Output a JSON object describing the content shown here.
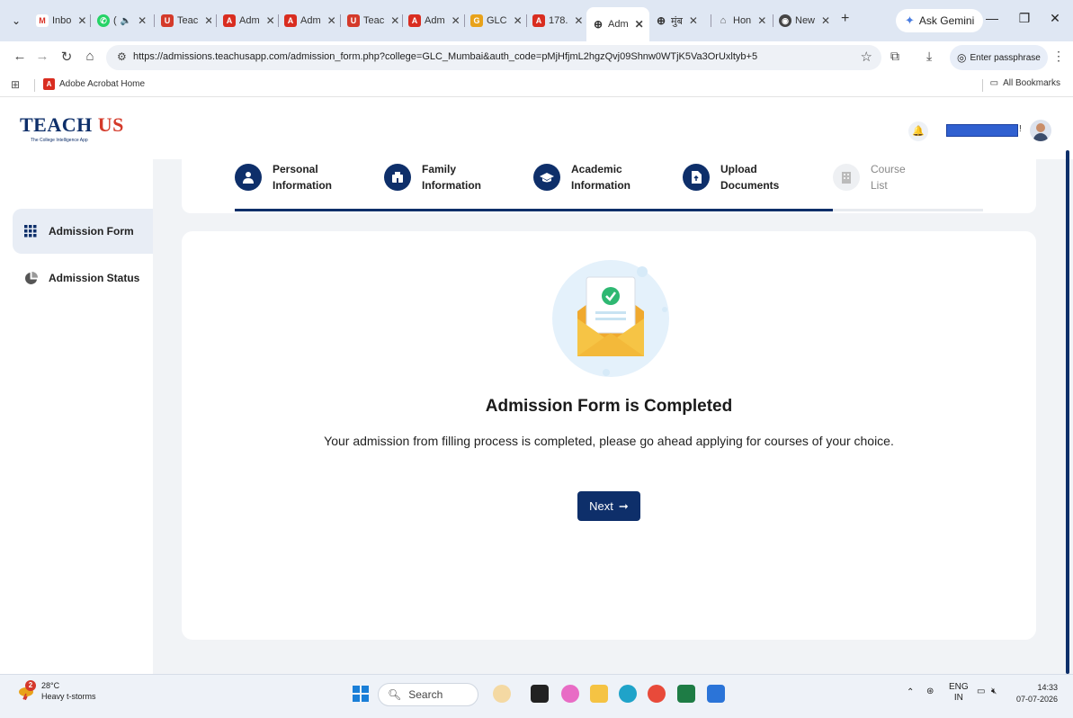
{
  "browser": {
    "tabs": [
      {
        "label": "Inbo",
        "icon": "gmail-icon",
        "color": "#d93025"
      },
      {
        "label": "(",
        "icon": "whatsapp-icon",
        "color": "#25d366"
      },
      {
        "label": "Teac",
        "icon": "teachus-icon",
        "color": "#d43a2a"
      },
      {
        "label": "Adm",
        "icon": "pdf-icon",
        "color": "#d92d20"
      },
      {
        "label": "Adm",
        "icon": "pdf-icon",
        "color": "#d92d20"
      },
      {
        "label": "Teac",
        "icon": "teachus-icon",
        "color": "#d43a2a"
      },
      {
        "label": "Adm",
        "icon": "pdf-icon",
        "color": "#d92d20"
      },
      {
        "label": "GLC",
        "icon": "glc-icon",
        "color": "#e8a21a"
      },
      {
        "label": "178.",
        "icon": "pdf-icon",
        "color": "#d92d20"
      },
      {
        "label": "Adm",
        "icon": "globe-icon",
        "color": "#444444",
        "active": true
      },
      {
        "label": "मुंब",
        "icon": "globe-icon",
        "color": "#444444"
      },
      {
        "label": "Hon",
        "icon": "bank-icon",
        "color": "#555555"
      },
      {
        "label": "New",
        "icon": "chrome-icon",
        "color": "#444444"
      }
    ],
    "gemini_label": "Ask Gemini",
    "url": "https://admissions.teachusapp.com/admission_form.php?college=GLC_Mumbai&auth_code=pMjHfjmL2hgzQvj09Shnw0WTjK5Va3OrUxltyb+5",
    "passphrase_label": "Enter passphrase",
    "bookmarks": [
      {
        "label": "Adobe Acrobat Home"
      }
    ],
    "all_bookmarks_label": "All Bookmarks"
  },
  "app": {
    "brand_teach": "TEACH ",
    "brand_us": "US",
    "brand_tagline": "The College Intelligence App",
    "user_suffix": "!",
    "sidebar": [
      {
        "label": "Admission Form",
        "icon": "grid-icon",
        "active": true
      },
      {
        "label": "Admission Status",
        "icon": "pie-chart-icon",
        "active": false
      }
    ],
    "steps": [
      {
        "line1": "Personal",
        "line2": "Information",
        "icon": "user-icon",
        "done": true
      },
      {
        "line1": "Family",
        "line2": "Information",
        "icon": "family-icon",
        "done": true
      },
      {
        "line1": "Academic",
        "line2": "Information",
        "icon": "graduation-cap-icon",
        "done": true
      },
      {
        "line1": "Upload",
        "line2": "Documents",
        "icon": "upload-document-icon",
        "done": true
      },
      {
        "line1": "Course",
        "line2": "List",
        "icon": "building-icon",
        "done": false
      }
    ],
    "main": {
      "title": "Admission Form is Completed",
      "message": "Your admission from filling process is completed, please go ahead applying for courses of your choice.",
      "next_label": "Next"
    },
    "colors": {
      "primary": "#0e2f6a",
      "accent": "#d43a2a"
    }
  },
  "taskbar": {
    "weather_badge": "2",
    "temperature": "28°C",
    "weather": "Heavy t-storms",
    "search_label": "Search",
    "lang_top": "ENG",
    "lang_bottom": "IN",
    "time": "14:33",
    "date": "07-07-2026"
  }
}
